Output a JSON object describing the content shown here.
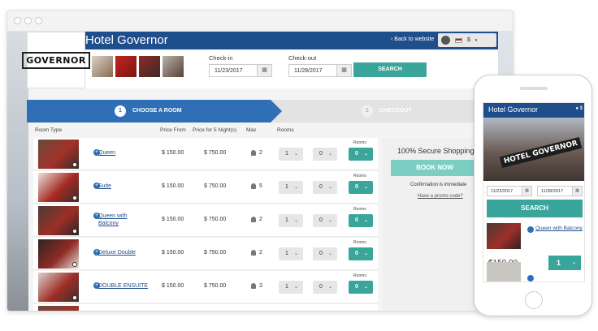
{
  "header": {
    "hotel_title": "Hotel Governor",
    "back_link": "‹ Back to website",
    "currency": "$",
    "logo_text": "GOVERNOR"
  },
  "search": {
    "checkin_label": "Check-in",
    "checkin_value": "11/23/2017",
    "checkout_label": "Check-out",
    "checkout_value": "11/28/2017",
    "search_button": "SEARCH"
  },
  "steps": [
    {
      "num": "1",
      "label": "CHOOSE A ROOM"
    },
    {
      "num": "2",
      "label": "CHECKOUT"
    }
  ],
  "table": {
    "headers": {
      "room_type": "Room Type",
      "price_from": "Price From",
      "price_for": "Price for 5 Night(s)",
      "max": "Max",
      "rooms": "Rooms"
    },
    "rooms_tag": "Rooms",
    "rows": [
      {
        "name": "Queen",
        "price_from": "$ 150.00",
        "price_total": "$ 750.00",
        "max": "2",
        "sel1": "1",
        "sel2": "0",
        "sel3": "0"
      },
      {
        "name": "Suite",
        "price_from": "$ 150.00",
        "price_total": "$ 750.00",
        "max": "5",
        "sel1": "1",
        "sel2": "0",
        "sel3": "0"
      },
      {
        "name": "Queen with Balcony",
        "price_from": "$ 150.00",
        "price_total": "$ 750.00",
        "max": "2",
        "sel1": "1",
        "sel2": "0",
        "sel3": "0"
      },
      {
        "name": "Deluxe Double",
        "price_from": "$ 150.00",
        "price_total": "$ 750.00",
        "max": "2",
        "sel1": "1",
        "sel2": "0",
        "sel3": "0"
      },
      {
        "name": "DOUBLE ENSUITE",
        "price_from": "$ 150.00",
        "price_total": "$ 750.00",
        "max": "3",
        "sel1": "1",
        "sel2": "0",
        "sel3": "0"
      }
    ]
  },
  "side": {
    "secure": "100% Secure Shopping",
    "book": "BOOK NOW",
    "confirm": "Confirmation is immediate",
    "promo": "Have a promo code?"
  },
  "mobile": {
    "title": "Hotel Governor",
    "currency": "$",
    "sign": "HOTEL GOVERNOR",
    "checkin": "11/23/2017",
    "checkout": "11/28/2017",
    "search": "SEARCH",
    "room_name": "Queen with Balcony",
    "price": "$150.00",
    "qty": "1"
  },
  "colors": {
    "brand_blue": "#1f4e8c",
    "step_blue": "#2f6fb7",
    "teal": "#3aa59b",
    "teal_light": "#7ccdc2"
  }
}
